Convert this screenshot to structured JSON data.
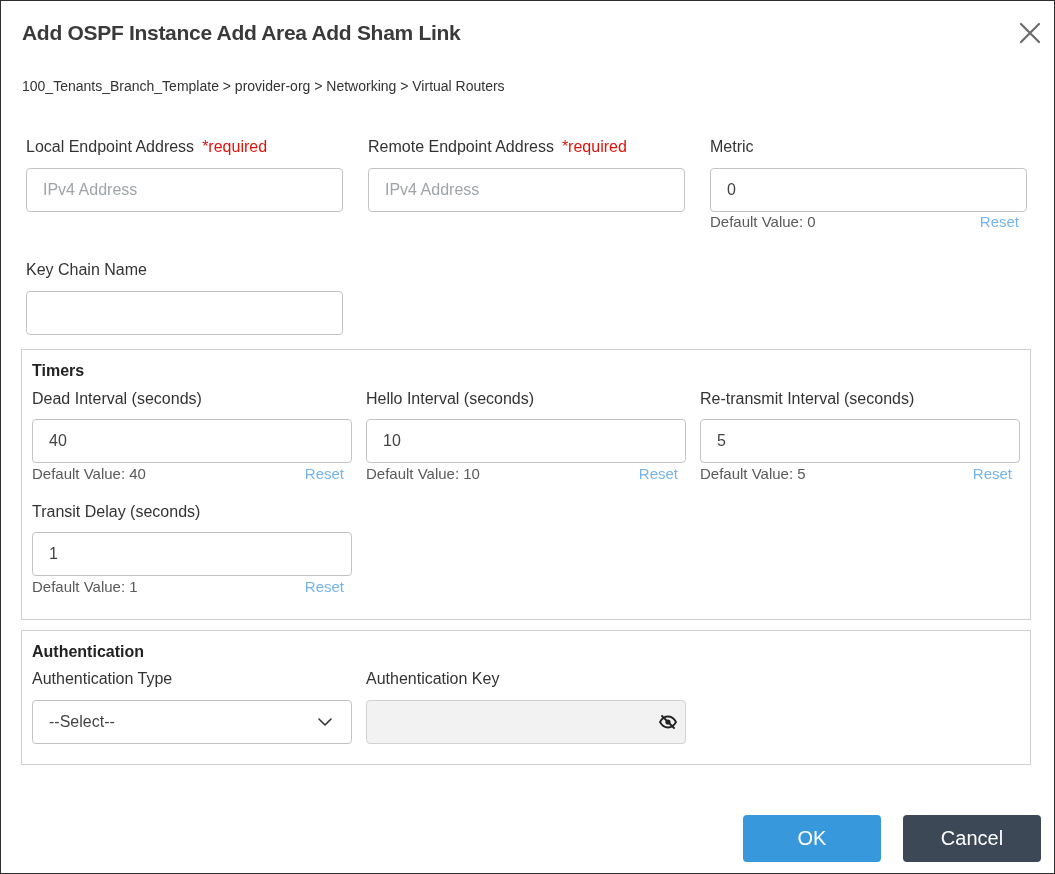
{
  "dialog": {
    "title": "Add OSPF Instance Add Area Add Sham Link",
    "breadcrumb": "100_Tenants_Branch_Template > provider-org > Networking > Virtual Routers"
  },
  "fields": [
    {
      "label": "Local Endpoint Address",
      "required": "*required",
      "placeholder": "IPv4 Address"
    },
    {
      "label": "Remote Endpoint Address",
      "required": "*required",
      "placeholder": "IPv4 Address"
    },
    {
      "label": "Metric",
      "value": "0",
      "default_note": "Default Value: 0",
      "reset": "Reset"
    },
    {
      "label": "Key Chain Name"
    }
  ],
  "timers": {
    "title": "Timers",
    "fields": [
      {
        "label": "Dead Interval (seconds)",
        "value": "40",
        "default_note": "Default Value: 40",
        "reset": "Reset"
      },
      {
        "label": "Hello Interval (seconds)",
        "value": "10",
        "default_note": "Default Value: 10",
        "reset": "Reset"
      },
      {
        "label": "Re-transmit Interval (seconds)",
        "value": "5",
        "default_note": "Default Value: 5",
        "reset": "Reset"
      },
      {
        "label": "Transit Delay (seconds)",
        "value": "1",
        "default_note": "Default Value: 1",
        "reset": "Reset"
      }
    ]
  },
  "authentication": {
    "title": "Authentication",
    "fields": [
      {
        "kind": "select",
        "label": "Authentication Type",
        "value": "--Select--"
      },
      {
        "kind": "password",
        "label": "Authentication Key",
        "disabled": true
      }
    ]
  },
  "buttons": [
    {
      "kind": "primary",
      "label": "OK"
    },
    {
      "kind": "secondary",
      "label": "Cancel"
    }
  ]
}
